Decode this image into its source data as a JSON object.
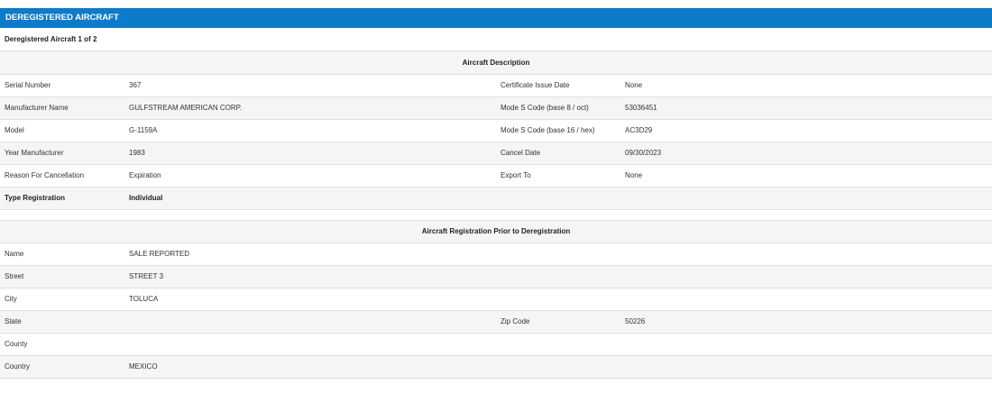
{
  "header": {
    "title": "DEREGISTERED AIRCRAFT",
    "subtitle": "Deregistered Aircraft 1 of 2"
  },
  "aircraft_description": {
    "section_title": "Aircraft Description",
    "rows": [
      {
        "l1": "Serial Number",
        "v1": "367",
        "l2": "Certificate Issue Date",
        "v2": "None"
      },
      {
        "l1": "Manufacturer Name",
        "v1": "GULFSTREAM AMERICAN CORP.",
        "l2": "Mode S Code (base 8 / oct)",
        "v2": "53036451"
      },
      {
        "l1": "Model",
        "v1": "G-1159A",
        "l2": "Mode S Code (base 16 / hex)",
        "v2": "AC3D29"
      },
      {
        "l1": "Year Manufacturer",
        "v1": "1983",
        "l2": "Cancel Date",
        "v2": "09/30/2023"
      },
      {
        "l1": "Reason For Cancellation",
        "v1": "Expiration",
        "l2": "Export To",
        "v2": "None"
      },
      {
        "l1": "Type Registration",
        "v1": "Individual",
        "l2": "",
        "v2": ""
      }
    ]
  },
  "registration_prior": {
    "section_title": "Aircraft Registration Prior to Deregistration",
    "rows": [
      {
        "l1": "Name",
        "v1": "SALE REPORTED",
        "l2": "",
        "v2": ""
      },
      {
        "l1": "Street",
        "v1": "STREET 3",
        "l2": "",
        "v2": ""
      },
      {
        "l1": "City",
        "v1": "TOLUCA",
        "l2": "",
        "v2": ""
      },
      {
        "l1": "State",
        "v1": "",
        "l2": "Zip Code",
        "v2": "50226"
      },
      {
        "l1": "County",
        "v1": "",
        "l2": "",
        "v2": ""
      },
      {
        "l1": "Country",
        "v1": "MEXICO",
        "l2": "",
        "v2": ""
      }
    ]
  },
  "colors": {
    "header_bg": "#0c7bc9",
    "shade_row": "#f5f5f5"
  }
}
